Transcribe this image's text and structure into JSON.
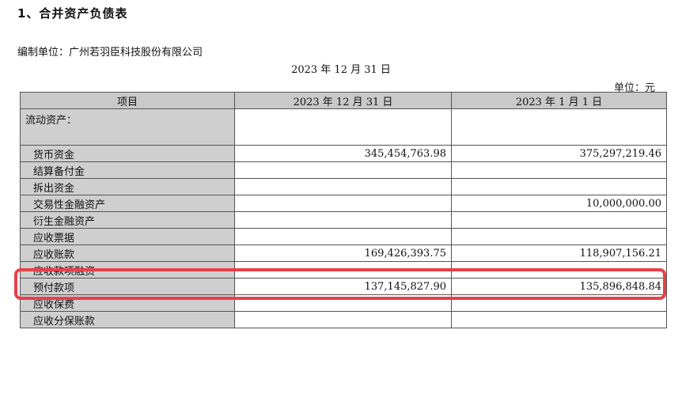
{
  "section_title": "1、合并资产负债表",
  "compiler": "编制单位：广州若羽臣科技股份有限公司",
  "report_date": "2023 年 12 月 31 日",
  "currency_unit": "单位：元",
  "columns": [
    "项目",
    "2023 年 12 月 31 日",
    "2023 年 1 月 1 日"
  ],
  "rows": [
    {
      "item": "流动资产：",
      "current": "",
      "prior": ""
    },
    {
      "item": "货币资金",
      "current": "345,454,763.98",
      "prior": "375,297,219.46"
    },
    {
      "item": "结算备付金",
      "current": "",
      "prior": ""
    },
    {
      "item": "拆出资金",
      "current": "",
      "prior": ""
    },
    {
      "item": "交易性金融资产",
      "current": "",
      "prior": "10,000,000.00"
    },
    {
      "item": "衍生金融资产",
      "current": "",
      "prior": ""
    },
    {
      "item": "应收票据",
      "current": "",
      "prior": ""
    },
    {
      "item": "应收账款",
      "current": "169,426,393.75",
      "prior": "118,907,156.21"
    },
    {
      "item": "应收款项融资",
      "current": "",
      "prior": ""
    },
    {
      "item": "预付款项",
      "current": "137,145,827.90",
      "prior": "135,896,848.84"
    },
    {
      "item": "应收保费",
      "current": "",
      "prior": ""
    },
    {
      "item": "应收分保账款",
      "current": "",
      "prior": ""
    }
  ],
  "highlight_color": "#e8404a"
}
